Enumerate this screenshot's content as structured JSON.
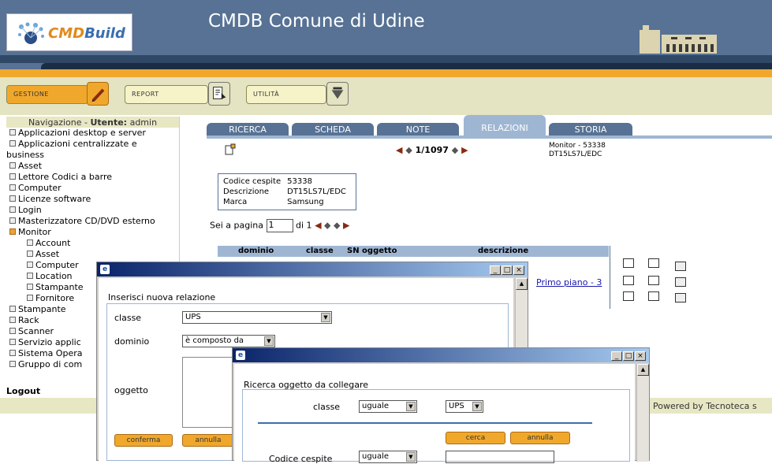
{
  "app": {
    "logo_text_prefix": "CMD",
    "logo_text_suffix": "Build",
    "title": "CMDB Comune di Udine",
    "colors": {
      "header": "#577294",
      "accent": "#f0a82c",
      "menu_bg": "#e4e3c2",
      "tab_active": "#9fb6d3"
    }
  },
  "topmenu": [
    {
      "label": "GESTIONE",
      "icon": "pencil-icon"
    },
    {
      "label": "REPORT",
      "icon": "report-icon"
    },
    {
      "label": "UTILITÀ",
      "icon": "tools-icon"
    }
  ],
  "nav": {
    "header_prefix": "Navigazione - ",
    "header_user_label": "Utente:",
    "header_user": "admin",
    "items": [
      "Applicazioni desktop e server",
      "Applicazioni centralizzate e",
      "business",
      "Asset",
      "Lettore Codici a barre",
      "Computer",
      "Licenze software",
      "Login",
      "Masterizzatore CD/DVD esterno",
      "Monitor",
      "Account",
      "Asset",
      "Computer",
      "Location",
      "Stampante",
      "Fornitore",
      "Stampante",
      "Rack",
      "Scanner",
      "Servizio applic",
      "Sistema Opera",
      "Gruppo di com"
    ],
    "logout": "Logout"
  },
  "tabs": [
    "RICERCA",
    "SCHEDA",
    "NOTE",
    "RELAZIONI",
    "STORIA"
  ],
  "record": {
    "pager": "1/1097",
    "label_line1": "Monitor - 53338",
    "label_line2": "DT15LS7L/EDC",
    "fields": [
      {
        "k": "Codice cespite",
        "v": "53338"
      },
      {
        "k": "Descrizione",
        "v": "DT15LS7L/EDC"
      },
      {
        "k": "Marca",
        "v": "Samsung"
      }
    ]
  },
  "pagination": {
    "label": "Sei a pagina",
    "value": "1",
    "of": "di 1"
  },
  "grid": {
    "headers": [
      "dominio",
      "classe",
      "SN oggetto",
      "descrizione"
    ],
    "row_link": "Primo piano - 3"
  },
  "dialog1": {
    "title_icon": "ie-icon",
    "legend": "Inserisci nuova relazione",
    "classe_label": "classe",
    "classe_value": "UPS",
    "dominio_label": "dominio",
    "dominio_value": "è composto da",
    "oggetto_label": "oggetto",
    "confirm": "conferma",
    "cancel": "annulla"
  },
  "dialog2": {
    "legend": "Ricerca oggetto da collegare",
    "classe_label": "classe",
    "op_value": "uguale",
    "classe_value": "UPS",
    "search": "cerca",
    "cancel": "annulla",
    "codice_label": "Codice cespite",
    "codice_op": "uguale"
  },
  "footer": {
    "powered": "Powered by Tecnoteca s"
  }
}
